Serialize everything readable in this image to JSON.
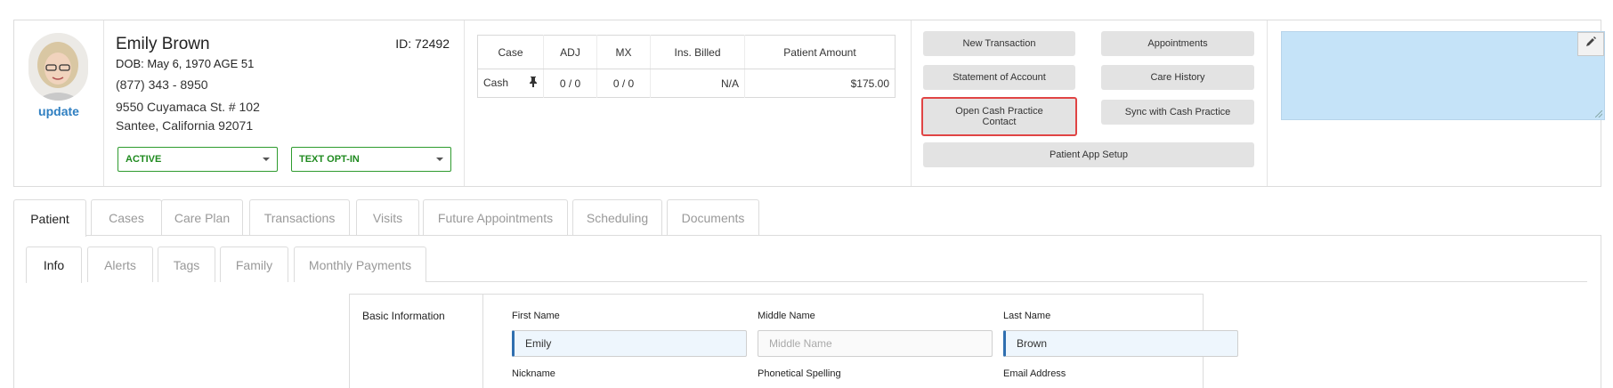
{
  "patient": {
    "name": "Emily Brown",
    "id_label": "ID: 72492",
    "dob": "DOB: May 6, 1970 AGE 51",
    "phone": "(877) 343 - 8950",
    "address_line1": "9550 Cuyamaca St. # 102",
    "address_line2": "Santee, California 92071",
    "update_link": "update",
    "status_select": "ACTIVE",
    "text_select": "TEXT OPT-IN"
  },
  "case_table": {
    "headers": [
      "Case",
      "ADJ",
      "MX",
      "Ins. Billed",
      "Patient Amount"
    ],
    "rows": [
      {
        "case": "Cash",
        "adj": "0 / 0",
        "mx": "0 / 0",
        "ins_billed": "N/A",
        "patient_amount": "$175.00"
      }
    ]
  },
  "actions": {
    "new_transaction": "New Transaction",
    "appointments": "Appointments",
    "statement": "Statement of Account",
    "care_history": "Care History",
    "open_cash_practice": "Open Cash Practice Contact",
    "sync_cash_practice": "Sync with Cash Practice",
    "app_setup": "Patient App Setup"
  },
  "main_tabs": [
    "Patient",
    "Cases",
    "Care Plan",
    "Transactions",
    "Visits",
    "Future Appointments",
    "Scheduling",
    "Documents"
  ],
  "sub_tabs": [
    "Info",
    "Alerts",
    "Tags",
    "Family",
    "Monthly Payments"
  ],
  "form": {
    "section_title": "Basic Information",
    "first_name_label": "First Name",
    "first_name_value": "Emily",
    "middle_name_label": "Middle Name",
    "middle_name_placeholder": "Middle Name",
    "last_name_label": "Last Name",
    "last_name_value": "Brown",
    "nickname_label": "Nickname",
    "phonetic_label": "Phonetical Spelling",
    "email_label": "Email Address"
  },
  "colors": {
    "accent_blue": "#2f7fc1",
    "status_green": "#1f8a1f",
    "amount_red": "#d60000",
    "notes_bg": "#c5e3f8",
    "highlight_border": "#e04444"
  }
}
